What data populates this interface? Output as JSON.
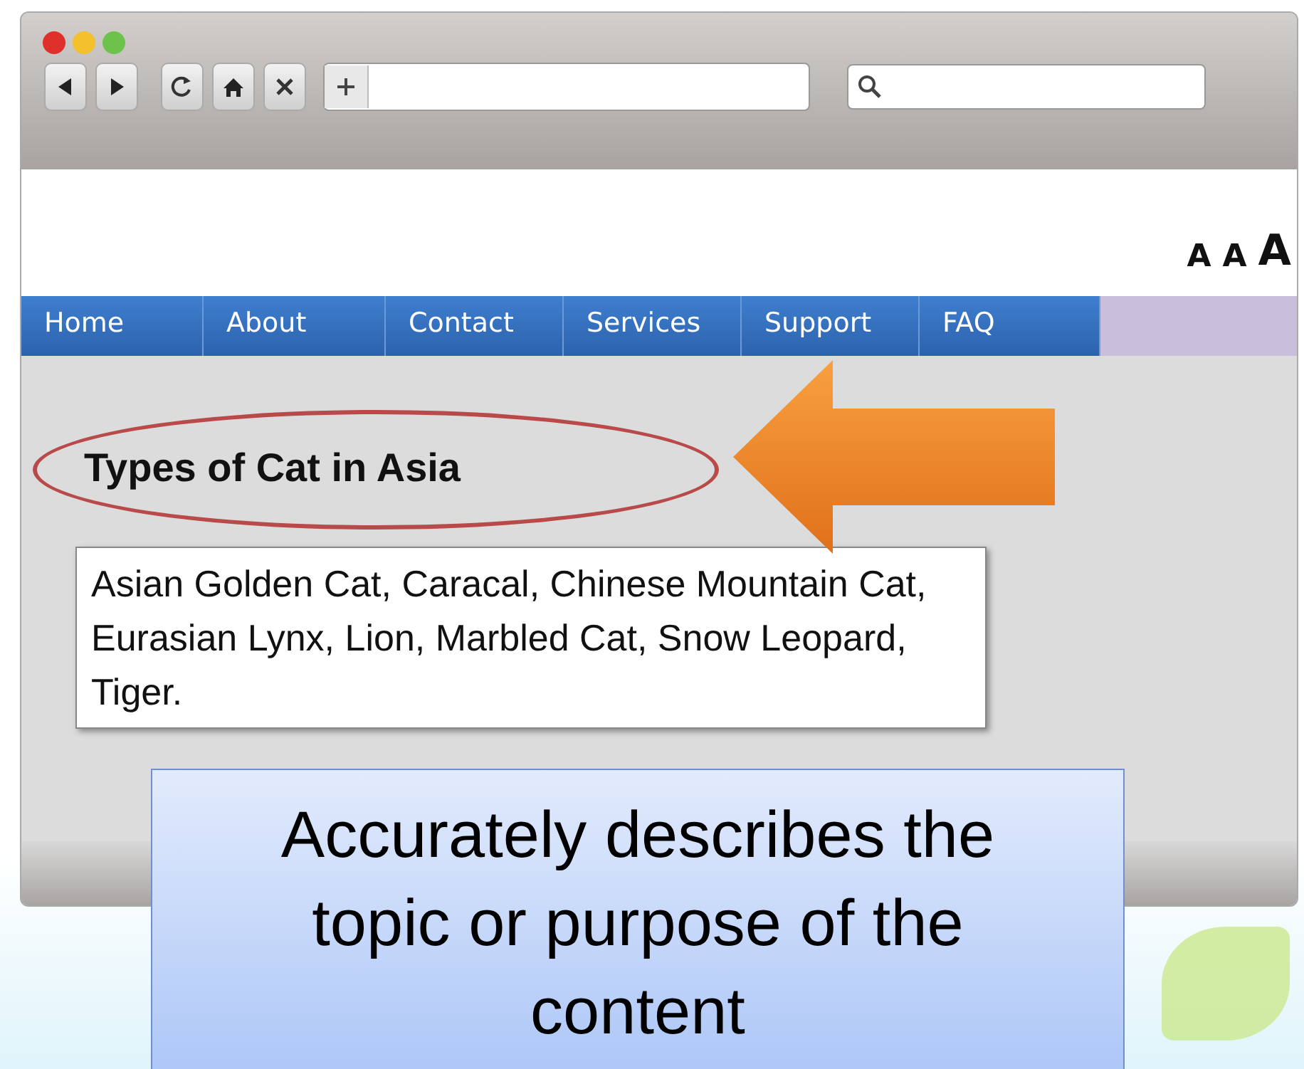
{
  "text_size_buttons": [
    "A",
    "A",
    "A"
  ],
  "nav": [
    {
      "label": "Home"
    },
    {
      "label": "About"
    },
    {
      "label": "Contact"
    },
    {
      "label": "Services"
    },
    {
      "label": "Support"
    },
    {
      "label": "FAQ"
    }
  ],
  "heading": "Types of Cat in Asia",
  "description": "Asian Golden Cat, Caracal, Chinese Mountain Cat, Eurasian Lynx, Lion, Marbled Cat, Snow Leopard, Tiger.",
  "callout": "Accurately describes the topic or purpose of the content"
}
